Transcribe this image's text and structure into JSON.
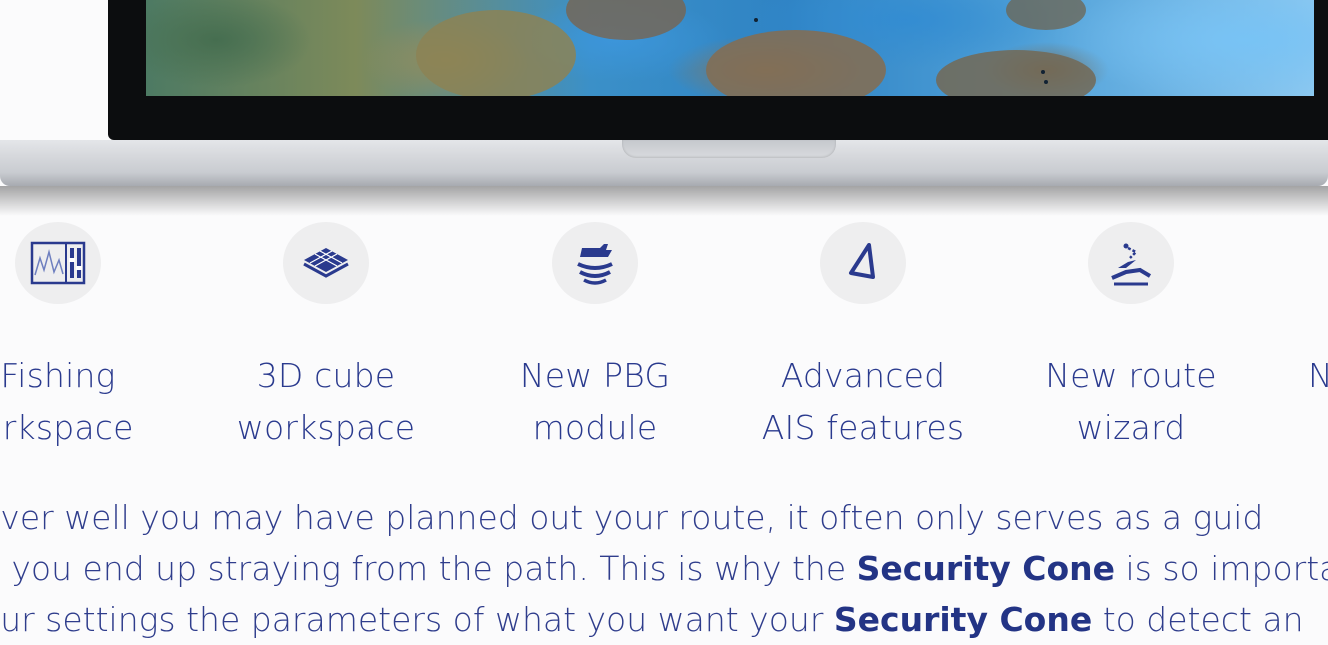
{
  "features": [
    {
      "icon": "fishing-workspace-icon",
      "label_line1": "Fishing",
      "label_line2": "orkspace"
    },
    {
      "icon": "3d-cube-icon",
      "label_line1": "3D cube",
      "label_line2": "workspace"
    },
    {
      "icon": "pbg-boat-icon",
      "label_line1": "New PBG",
      "label_line2": "module"
    },
    {
      "icon": "ais-triangle-icon",
      "label_line1": "Advanced",
      "label_line2": "AIS features"
    },
    {
      "icon": "route-wizard-icon",
      "label_line1": "New route",
      "label_line2": "wizard"
    },
    {
      "icon": "",
      "label_line1": "N",
      "label_line2": ""
    }
  ],
  "paragraph": {
    "line1": "ever well you may have planned out your route, it often only serves as a guid",
    "line2_pre": "n you end up straying from the path. This is why the ",
    "line2_bold": "Security Cone",
    "line2_post": " is so importar",
    "line3_pre": "our settings the parameters of what you want your ",
    "line3_bold": "Security Cone",
    "line3_post": " to detect an"
  },
  "colors": {
    "accent": "#2a3a8e",
    "icon_bg": "#eeeeef"
  }
}
